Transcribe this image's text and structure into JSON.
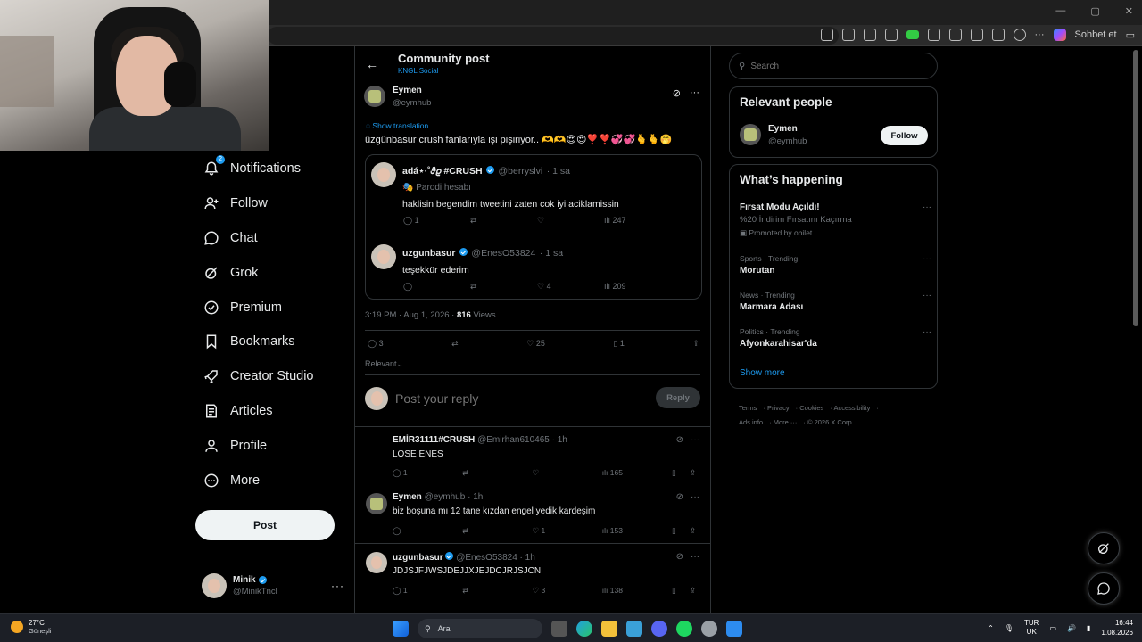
{
  "browser": {
    "copilot_label": "Sohbet et"
  },
  "nav": {
    "items": [
      {
        "label": "Notifications",
        "icon": "bell-icon",
        "badge": "2"
      },
      {
        "label": "Follow",
        "icon": "person-add-icon"
      },
      {
        "label": "Chat",
        "icon": "chat-icon"
      },
      {
        "label": "Grok",
        "icon": "grok-icon"
      },
      {
        "label": "Premium",
        "icon": "premium-icon"
      },
      {
        "label": "Bookmarks",
        "icon": "bookmark-icon"
      },
      {
        "label": "Creator Studio",
        "icon": "rocket-icon"
      },
      {
        "label": "Articles",
        "icon": "articles-icon"
      },
      {
        "label": "Profile",
        "icon": "person-icon"
      },
      {
        "label": "More",
        "icon": "more-circle-icon"
      }
    ],
    "post_button": "Post",
    "account": {
      "name": "Minik",
      "handle": "@MinikTncl"
    }
  },
  "header": {
    "title": "Community post",
    "subtitle": "KNGL Social"
  },
  "post": {
    "author_name": "Eymen",
    "author_handle": "@eymhub",
    "show_translation": "Show translation",
    "text": "üzgünbasur crush fanlarıyla işi pişiriyor.. 🫶🫶😍😍❣️❣️💞💞🫰🫰🤭",
    "quote": {
      "first": {
        "name": "adá⋆·˚𝜗𝜚 #CRUSH",
        "handle": "@berryslvi",
        "time": "1 sa",
        "parody": "Parodi hesabı",
        "text": "haklisin begendim tweetini zaten cok iyi aciklamissin",
        "replies": "1",
        "likes": "",
        "views": "247"
      },
      "second": {
        "name": "uzgunbasur",
        "handle": "@EnesO53824",
        "time": "1 sa",
        "text": "teşekkür ederim",
        "likes": "4",
        "views": "209"
      }
    },
    "timestamp": "3:19 PM · Aug 1, 2026 · ",
    "views_count": "816",
    "views_label": " Views",
    "stats": {
      "replies": "3",
      "likes": "25",
      "bookmarks": "1"
    },
    "sort_label": "Relevant"
  },
  "reply_box": {
    "placeholder": "Post your reply",
    "button": "Reply"
  },
  "replies": [
    {
      "name": "EMİR31111#CRUSH",
      "handle": "@Emirhan610465",
      "time": "1h",
      "text": "LOSE ENES",
      "replies": "1",
      "likes": "",
      "views": "165"
    },
    {
      "name": "Eymen",
      "handle": "@eymhub",
      "time": "1h",
      "text": "biz boşuna mı 12 tane kızdan engel yedik kardeşim",
      "replies": "",
      "likes": "1",
      "views": "153"
    },
    {
      "name": "uzgunbasur",
      "handle": "@EnesO53824",
      "time": "1h",
      "text": "JDJSJFJWSJDEJJXJEJDCJRJSJCN",
      "replies": "1",
      "likes": "3",
      "views": "138"
    }
  ],
  "right": {
    "search_placeholder": "Search",
    "relevant_title": "Relevant people",
    "person": {
      "name": "Eymen",
      "handle": "@eymhub",
      "button": "Follow"
    },
    "happening_title": "What’s happening",
    "trends": [
      {
        "category": "",
        "name": "Fırsat Modu Açıldı!",
        "sub": "%20 İndirim Fırsatını Kaçırma",
        "promo": "Promoted by obilet"
      },
      {
        "category": "Sports · Trending",
        "name": "Morutan"
      },
      {
        "category": "News · Trending",
        "name": "Marmara Adası"
      },
      {
        "category": "Politics · Trending",
        "name": "Afyonkarahisar'da"
      }
    ],
    "show_more": "Show more",
    "footer": [
      "Terms",
      "Privacy",
      "Cookies",
      "Accessibility",
      "Ads info",
      "More ···",
      "© 2026 X Corp."
    ]
  },
  "taskbar": {
    "temp": "27°C",
    "weather": "Güneşli",
    "search": "Ara",
    "lang_top": "TUR",
    "lang_bottom": "UK",
    "time": "16:44",
    "date": "1.08.2026"
  },
  "colors": {
    "accent": "#1d9bf0",
    "bg": "#000000",
    "muted": "#71767b",
    "border": "#2f3336"
  }
}
